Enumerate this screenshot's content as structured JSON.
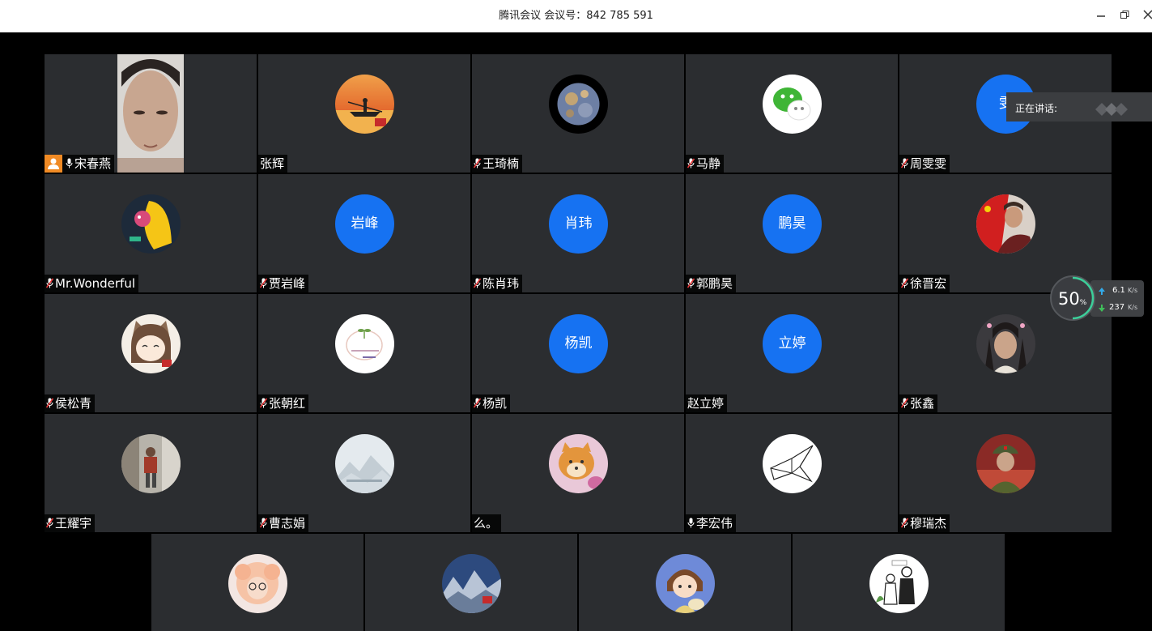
{
  "window": {
    "title": "腾讯会议 会议号：842 785 591"
  },
  "colors": {
    "accent": "#1672f2",
    "host": "#f08a24",
    "tile_bg": "#2b2d30"
  },
  "participants": [
    {
      "name": "宋春燕",
      "avatar": "video",
      "mic": "on",
      "host": true
    },
    {
      "name": "张辉",
      "avatar": "photo-kayak",
      "mic": "none"
    },
    {
      "name": "王琦楠",
      "avatar": "photo-planet",
      "mic": "muted"
    },
    {
      "name": "马静",
      "avatar": "wechat-logo",
      "mic": "muted"
    },
    {
      "name": "周雯雯",
      "avatar_text": "雯",
      "mic": "muted"
    },
    {
      "name": "Mr.Wonderful",
      "avatar": "photo-cartoon-yellow",
      "mic": "muted"
    },
    {
      "name": "贾岩峰",
      "avatar_text": "岩峰",
      "mic": "muted"
    },
    {
      "name": "陈肖玮",
      "avatar_text": "肖玮",
      "mic": "muted"
    },
    {
      "name": "郭鹏昊",
      "avatar_text": "鹏昊",
      "mic": "muted"
    },
    {
      "name": "徐晋宏",
      "avatar": "photo-flag-person",
      "mic": "muted"
    },
    {
      "name": "侯松青",
      "avatar": "photo-cat-girl",
      "mic": "muted"
    },
    {
      "name": "张朝红",
      "avatar": "photo-sprout",
      "mic": "muted"
    },
    {
      "name": "杨凯",
      "avatar_text": "杨凯",
      "mic": "muted"
    },
    {
      "name": "赵立婷",
      "avatar_text": "立婷",
      "mic": "none"
    },
    {
      "name": "张鑫",
      "avatar": "photo-costume",
      "mic": "muted"
    },
    {
      "name": "王耀宇",
      "avatar": "photo-street",
      "mic": "muted"
    },
    {
      "name": "曹志娟",
      "avatar": "photo-mountains",
      "mic": "muted"
    },
    {
      "name": "么。",
      "avatar": "photo-shiba",
      "mic": "none"
    },
    {
      "name": "李宏伟",
      "avatar": "photo-paper-crane",
      "mic": "on"
    },
    {
      "name": "穆瑞杰",
      "avatar": "photo-soldier",
      "mic": "muted"
    },
    {
      "name": "",
      "avatar": "photo-pink-fluffy",
      "mic": "none"
    },
    {
      "name": "",
      "avatar": "photo-great-wall",
      "mic": "none"
    },
    {
      "name": "",
      "avatar": "photo-anime-girl",
      "mic": "none"
    },
    {
      "name": "",
      "avatar": "photo-couple-illustration",
      "mic": "none"
    }
  ],
  "speaking": {
    "label": "正在讲话:"
  },
  "network": {
    "cpu": "50",
    "cpu_unit": "%",
    "up": "6.1",
    "up_unit": "K/s",
    "down": "237",
    "down_unit": "K/s"
  }
}
